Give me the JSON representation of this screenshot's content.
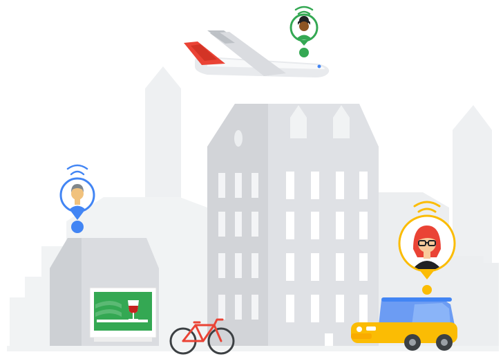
{
  "illustration": {
    "background_color": "#ffffff",
    "colors": {
      "building_light": "#e8eaed",
      "building_mid": "#dadce0",
      "building_dark": "#bdc1c6",
      "window": "#ffffff",
      "pin_blue": "#4285f4",
      "pin_green": "#34a853",
      "pin_yellow": "#fbbc04",
      "plane_red": "#ea4335",
      "car_blue": "#6c9cf3",
      "car_yellow": "#fbbc04",
      "bike_red": "#ea4335",
      "sign_green": "#34a853",
      "wine_red": "#c5221f"
    },
    "location_pins": [
      {
        "name": "traveler-on-plane",
        "color": "pin_green",
        "icon": "woman-avatar-icon"
      },
      {
        "name": "person-at-restaurant",
        "color": "pin_blue",
        "icon": "man-avatar-icon"
      },
      {
        "name": "driver-in-car",
        "color": "pin_yellow",
        "icon": "woman-glasses-avatar-icon"
      }
    ]
  }
}
